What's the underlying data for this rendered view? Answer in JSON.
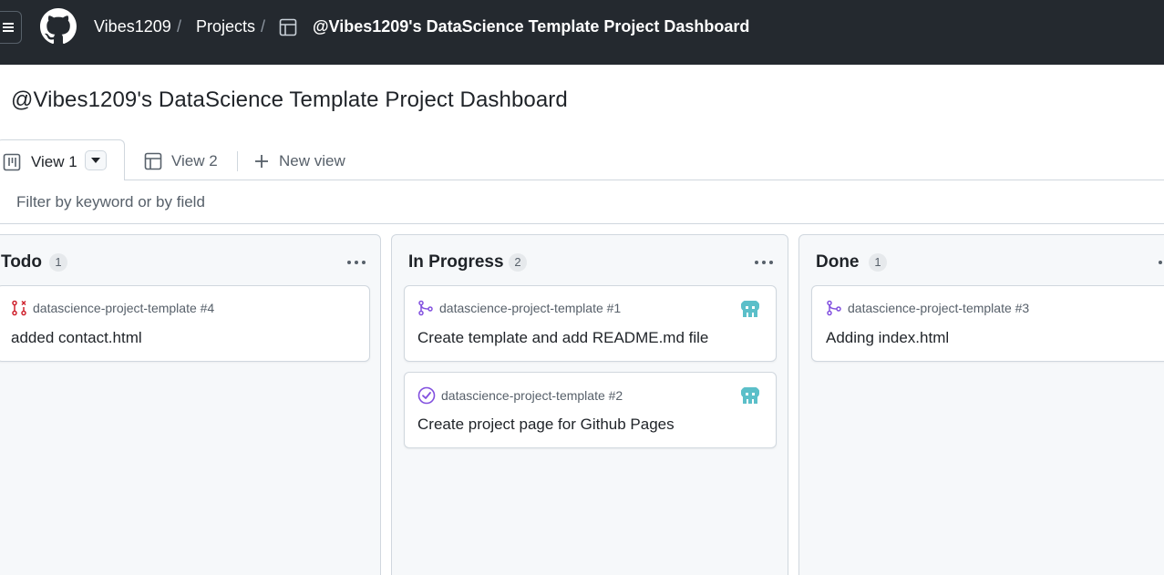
{
  "header": {
    "user": "Vibes1209",
    "projects": "Projects",
    "project_title": "@Vibes1209's DataScience Template Project Dashboard",
    "separator": "/"
  },
  "page": {
    "title": "@Vibes1209's DataScience Template Project Dashboard"
  },
  "tabs": [
    {
      "label": "View 1",
      "icon": "board-icon",
      "active": true
    },
    {
      "label": "View 2",
      "icon": "table-icon",
      "active": false
    }
  ],
  "new_view_label": "New view",
  "filter": {
    "placeholder": "Filter by keyword or by field",
    "value": ""
  },
  "columns": [
    {
      "name": "Todo",
      "count": "1",
      "cards": [
        {
          "repo": "datascience-project-template #4",
          "title": "added contact.html",
          "icon": "pull-request-closed-icon",
          "icon_color": "#cf222e",
          "avatar": false
        }
      ]
    },
    {
      "name": "In Progress",
      "count": "2",
      "cards": [
        {
          "repo": "datascience-project-template #1",
          "title": "Create template and add README.md file",
          "icon": "pull-request-merged-icon",
          "icon_color": "#8250df",
          "avatar": true
        },
        {
          "repo": "datascience-project-template #2",
          "title": "Create project page for Github Pages",
          "icon": "issue-closed-icon",
          "icon_color": "#8250df",
          "avatar": true
        }
      ]
    },
    {
      "name": "Done",
      "count": "1",
      "cards": [
        {
          "repo": "datascience-project-template #3",
          "title": "Adding index.html",
          "icon": "pull-request-merged-icon",
          "icon_color": "#8250df",
          "avatar": false
        }
      ]
    }
  ],
  "colors": {
    "header_bg": "#24292f",
    "column_bg": "#f6f8fa",
    "border": "#d0d7de",
    "merged_purple": "#8250df",
    "closed_red": "#cf222e",
    "avatar_teal": "#5bbfc9"
  }
}
